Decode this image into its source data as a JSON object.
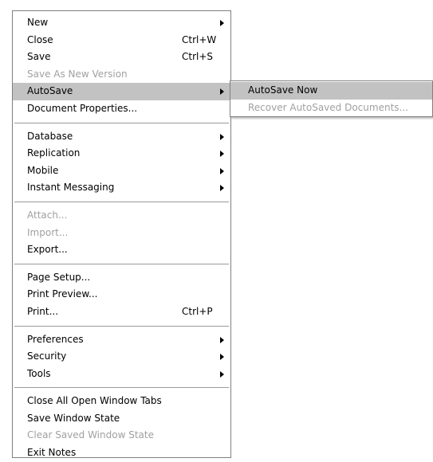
{
  "menu": {
    "items": [
      {
        "label": "New",
        "submenu": true
      },
      {
        "label": "Close",
        "shortcut": "Ctrl+W"
      },
      {
        "label": "Save",
        "shortcut": "Ctrl+S"
      },
      {
        "label": "Save As New Version",
        "disabled": true
      },
      {
        "label": "AutoSave",
        "submenu": true,
        "highlighted": true
      },
      {
        "label": "Document Properties..."
      },
      {
        "label": "Database",
        "submenu": true
      },
      {
        "label": "Replication",
        "submenu": true
      },
      {
        "label": "Mobile",
        "submenu": true
      },
      {
        "label": "Instant Messaging",
        "submenu": true
      },
      {
        "label": "Attach...",
        "disabled": true
      },
      {
        "label": "Import...",
        "disabled": true
      },
      {
        "label": "Export..."
      },
      {
        "label": "Page Setup..."
      },
      {
        "label": "Print Preview..."
      },
      {
        "label": "Print...",
        "shortcut": "Ctrl+P"
      },
      {
        "label": "Preferences",
        "submenu": true
      },
      {
        "label": "Security",
        "submenu": true
      },
      {
        "label": "Tools",
        "submenu": true
      },
      {
        "label": "Close All Open Window Tabs"
      },
      {
        "label": "Save Window State"
      },
      {
        "label": "Clear Saved Window State",
        "disabled": true
      },
      {
        "label": "Exit Notes"
      }
    ]
  },
  "autosave_submenu": {
    "items": [
      {
        "label": "AutoSave Now",
        "highlighted": true
      },
      {
        "label": "Recover AutoSaved Documents...",
        "disabled": true
      }
    ]
  },
  "colors": {
    "highlight": "#c2c2c2",
    "disabled_text": "#a0a0a0",
    "border": "#7f7f7f"
  }
}
